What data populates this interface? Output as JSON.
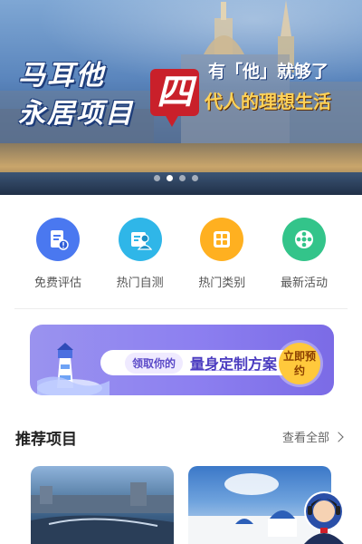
{
  "banner": {
    "title_line1": "马耳他",
    "title_line2": "永居项目",
    "highlight_char": "四",
    "slogan_line1": "有「他」就够了",
    "slogan_line2": "代人的理想生活",
    "dots_total": 4,
    "dots_active_index": 1
  },
  "menu": {
    "items": [
      {
        "label": "免费评估",
        "icon": "clipboard-icon",
        "color": "#4a78f0"
      },
      {
        "label": "热门自测",
        "icon": "person-card-icon",
        "color": "#2fb6e8"
      },
      {
        "label": "热门类别",
        "icon": "grid-icon",
        "color": "#ffb020"
      },
      {
        "label": "最新活动",
        "icon": "film-reel-icon",
        "color": "#33c48a"
      }
    ]
  },
  "promo": {
    "tag": "领取你的",
    "main": "量身定制方案",
    "button": "立即预约",
    "accent": "#8c7ff0"
  },
  "recommend": {
    "title": "推荐项目",
    "more": "查看全部"
  }
}
